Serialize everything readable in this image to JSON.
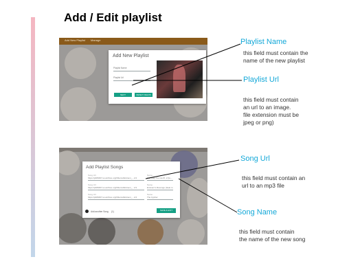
{
  "page": {
    "title": "Add / Edit playlist"
  },
  "colors": {
    "accent_annotation": "#13a8d8",
    "app_bar": "#8a5a1a",
    "button": "#16a085"
  },
  "screen1": {
    "tabs": [
      "Add New Playlist",
      "Manage"
    ],
    "dialog_title": "Add New Playlist",
    "name_placeholder": "Playlist Name",
    "url_placeholder": "Playlist Url",
    "buttons": {
      "next": "NEXT",
      "reset": "RESET FIELDS"
    }
  },
  "screen2": {
    "dialog_title": "Add Playlist Songs",
    "song_url_label": "Song Url",
    "song_name_label": "Name",
    "rows": [
      {
        "url": "https://pb83467.us.archive.org/3/items/Eminem_...d.3",
        "name": "The Way You Lie Pt. 2 (fe..."
      },
      {
        "url": "https://pb83467.us.archive.org/3/items/Eminem_...d.3",
        "name": "Eminem's Revenge (Heat m..."
      },
      {
        "url": "https://pb83467.us.archive.org/3/items/Eminem_...d.3",
        "name": "The Cypher"
      }
    ],
    "add_more_label": "Add another Song",
    "add_more_count": "(1)",
    "save_button": "SAVE & EXIT"
  },
  "annotations": {
    "playlist_name": {
      "label": "Playlist Name",
      "desc": [
        "this field must contain the",
        "name of the new playlist"
      ]
    },
    "playlist_url": {
      "label": "Playlist Url",
      "desc": [
        "this field must contain",
        "an url to an image.",
        " file extension must be",
        "jpeg or png)"
      ]
    },
    "song_url": {
      "label": "Song Url",
      "desc": [
        "this field must contain an",
        " url to an mp3 file"
      ]
    },
    "song_name": {
      "label": "Song Name",
      "desc": [
        "this field must contain",
        "the name of the new song"
      ]
    }
  }
}
